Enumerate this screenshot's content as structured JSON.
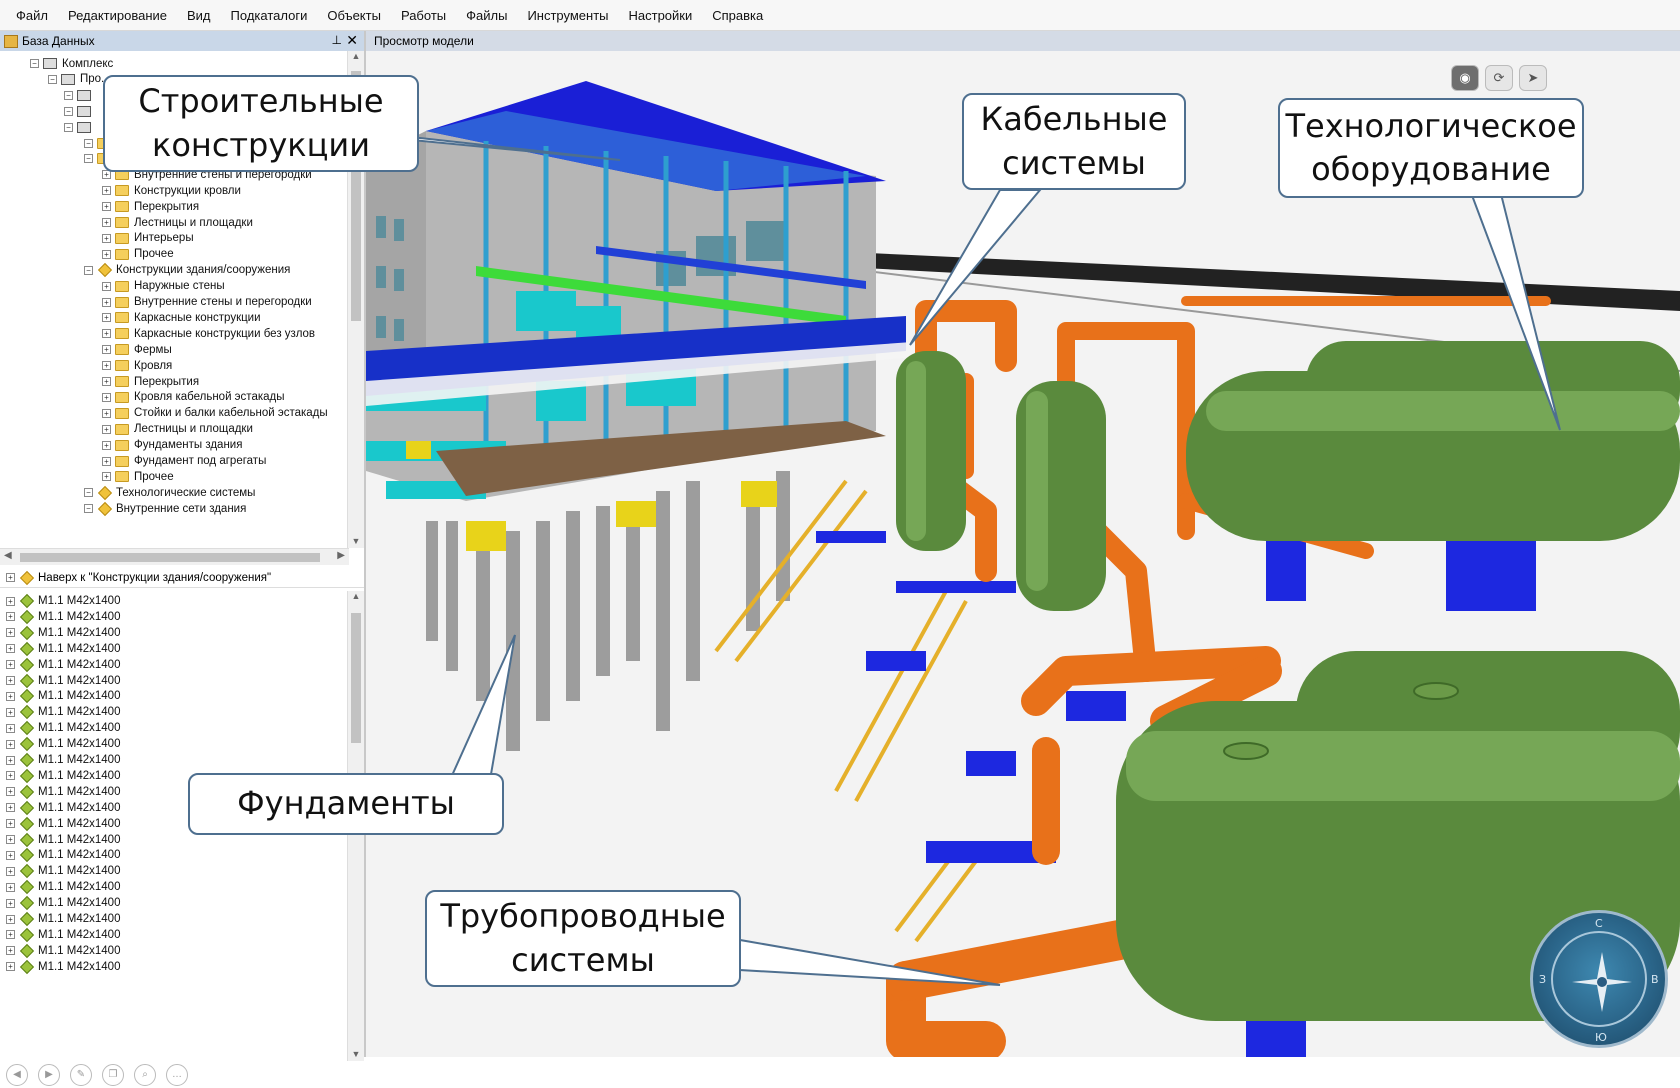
{
  "menu": [
    "Файл",
    "Редактирование",
    "Вид",
    "Подкаталоги",
    "Объекты",
    "Работы",
    "Файлы",
    "Инструменты",
    "Настройки",
    "Справка"
  ],
  "left_panel": {
    "title": "База Данных",
    "tree": [
      {
        "label": "Комплекс",
        "level": 1,
        "icon": "building-icon"
      },
      {
        "label": "Про...",
        "level": 2,
        "icon": "axis-icon"
      },
      {
        "label": "",
        "level": 3,
        "icon": "building-icon"
      },
      {
        "label": "",
        "level": 3,
        "icon": "building-icon"
      },
      {
        "label": "",
        "level": 3,
        "icon": "building-icon"
      },
      {
        "label": "",
        "level": 4,
        "icon": "folder-icon"
      },
      {
        "label": "",
        "level": 4,
        "icon": "folder-icon"
      },
      {
        "label": "Внутренние стены и перегородки",
        "level": 5,
        "icon": "folder-icon"
      },
      {
        "label": "Конструкции кровли",
        "level": 5,
        "icon": "folder-icon"
      },
      {
        "label": "Перекрытия",
        "level": 5,
        "icon": "folder-icon"
      },
      {
        "label": "Лестницы и площадки",
        "level": 5,
        "icon": "folder-icon"
      },
      {
        "label": "Интерьеры",
        "level": 5,
        "icon": "folder-icon"
      },
      {
        "label": "Прочее",
        "level": 5,
        "icon": "folder-icon"
      },
      {
        "label": "Конструкции здания/сооружения",
        "level": 4,
        "icon": "category-icon"
      },
      {
        "label": "Наружные стены",
        "level": 5,
        "icon": "folder-icon"
      },
      {
        "label": "Внутренние стены и перегородки",
        "level": 5,
        "icon": "folder-icon"
      },
      {
        "label": "Каркасные конструкции",
        "level": 5,
        "icon": "folder-icon"
      },
      {
        "label": "Каркасные конструкции без узлов",
        "level": 5,
        "icon": "folder-icon"
      },
      {
        "label": "Фермы",
        "level": 5,
        "icon": "folder-icon"
      },
      {
        "label": "Кровля",
        "level": 5,
        "icon": "folder-icon"
      },
      {
        "label": "Перекрытия",
        "level": 5,
        "icon": "folder-icon"
      },
      {
        "label": "Кровля кабельной эстакады",
        "level": 5,
        "icon": "folder-icon"
      },
      {
        "label": "Стойки и балки кабельной эстакады",
        "level": 5,
        "icon": "folder-icon"
      },
      {
        "label": "Лестницы и площадки",
        "level": 5,
        "icon": "folder-icon"
      },
      {
        "label": "Фундаменты здания",
        "level": 5,
        "icon": "folder-icon"
      },
      {
        "label": "Фундамент под агрегаты",
        "level": 5,
        "icon": "folder-icon"
      },
      {
        "label": "Прочее",
        "level": 5,
        "icon": "folder-icon"
      },
      {
        "label": "Технологические системы",
        "level": 4,
        "icon": "category-icon"
      },
      {
        "label": "Внутренние сети здания",
        "level": 4,
        "icon": "category-icon"
      }
    ],
    "up_link": "Наверх к \"Конструкции здания/сооружения\"",
    "items": [
      "M1.1 M42x1400",
      "M1.1 M42x1400",
      "M1.1 M42x1400",
      "M1.1 M42x1400",
      "M1.1 M42x1400",
      "M1.1 M42x1400",
      "M1.1 M42x1400",
      "M1.1 M42x1400",
      "M1.1 M42x1400",
      "M1.1 M42x1400",
      "M1.1 M42x1400",
      "M1.1 M42x1400",
      "M1.1 M42x1400",
      "M1.1 M42x1400",
      "M1.1 M42x1400",
      "M1.1 M42x1400",
      "M1.1 M42x1400",
      "M1.1 M42x1400",
      "M1.1 M42x1400",
      "M1.1 M42x1400",
      "M1.1 M42x1400",
      "M1.1 M42x1400",
      "M1.1 M42x1400",
      "M1.1 M42x1400"
    ]
  },
  "view": {
    "title": "Просмотр модели",
    "tools": [
      "eye-icon",
      "rotate-icon",
      "navigate-icon"
    ]
  },
  "callouts": {
    "construction": "Строительные конструкции",
    "cable": "Кабельные системы",
    "equipment": "Технологическое оборудование",
    "foundations": "Фундаменты",
    "pipes": "Трубопроводные системы"
  },
  "compass": {
    "n": "С",
    "s": "Ю",
    "e": "В",
    "w": "З"
  }
}
